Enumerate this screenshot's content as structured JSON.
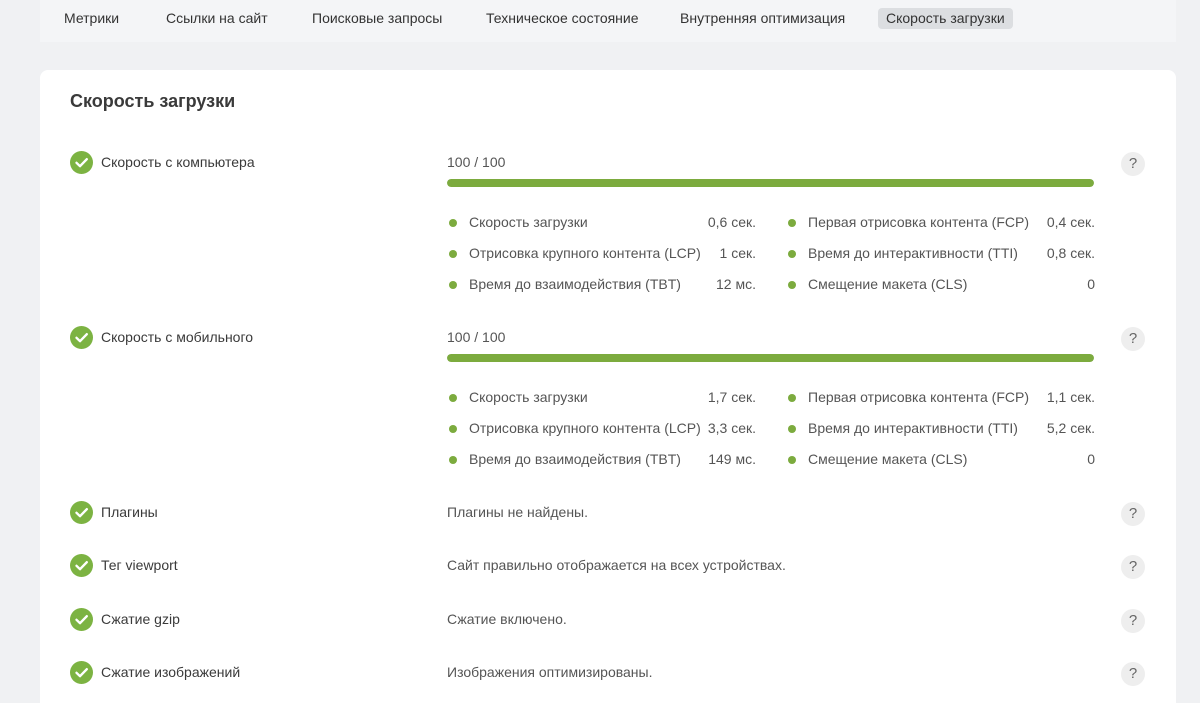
{
  "tabs": [
    {
      "label": "Метрики",
      "active": false
    },
    {
      "label": "Ссылки на сайт",
      "active": false
    },
    {
      "label": "Поисковые запросы",
      "active": false
    },
    {
      "label": "Техническое состояние",
      "active": false
    },
    {
      "label": "Внутренняя оптимизация",
      "active": false
    },
    {
      "label": "Скорость загрузки",
      "active": true
    }
  ],
  "section": {
    "title": "Скорость загрузки",
    "help_label": "?",
    "desktop": {
      "label": "Скорость с компьютера",
      "score_text": "100 / 100",
      "score": 100,
      "max": 100,
      "metrics": [
        {
          "label": "Скорость загрузки",
          "value": "0,6 сек."
        },
        {
          "label": "Первая отрисовка контента (FCP)",
          "value": "0,4 сек."
        },
        {
          "label": "Отрисовка крупного контента (LCP)",
          "value": "1 сек."
        },
        {
          "label": "Время до интерактивности (TTI)",
          "value": "0,8 сек."
        },
        {
          "label": "Время до взаимодействия (TBT)",
          "value": "12 мс."
        },
        {
          "label": "Смещение макета (CLS)",
          "value": "0"
        }
      ]
    },
    "mobile": {
      "label": "Скорость с мобильного",
      "score_text": "100 / 100",
      "score": 100,
      "max": 100,
      "metrics": [
        {
          "label": "Скорость загрузки",
          "value": "1,7 сек."
        },
        {
          "label": "Первая отрисовка контента (FCP)",
          "value": "1,1 сек."
        },
        {
          "label": "Отрисовка крупного контента (LCP)",
          "value": "3,3 сек."
        },
        {
          "label": "Время до интерактивности (TTI)",
          "value": "5,2 сек."
        },
        {
          "label": "Время до взаимодействия (TBT)",
          "value": "149 мс."
        },
        {
          "label": "Смещение макета (CLS)",
          "value": "0"
        }
      ]
    },
    "checks": [
      {
        "label": "Плагины",
        "description": "Плагины не найдены."
      },
      {
        "label": "Тег viewport",
        "description": "Сайт правильно отображается на всех устройствах."
      },
      {
        "label": "Сжатие gzip",
        "description": "Сжатие включено."
      },
      {
        "label": "Сжатие изображений",
        "description": "Изображения оптимизированы."
      }
    ]
  },
  "colors": {
    "accent": "#7cab3e",
    "check": "#7cb342"
  },
  "icons": {
    "check": "check-circle-icon",
    "help": "question-icon",
    "bullet": "dot-icon"
  }
}
